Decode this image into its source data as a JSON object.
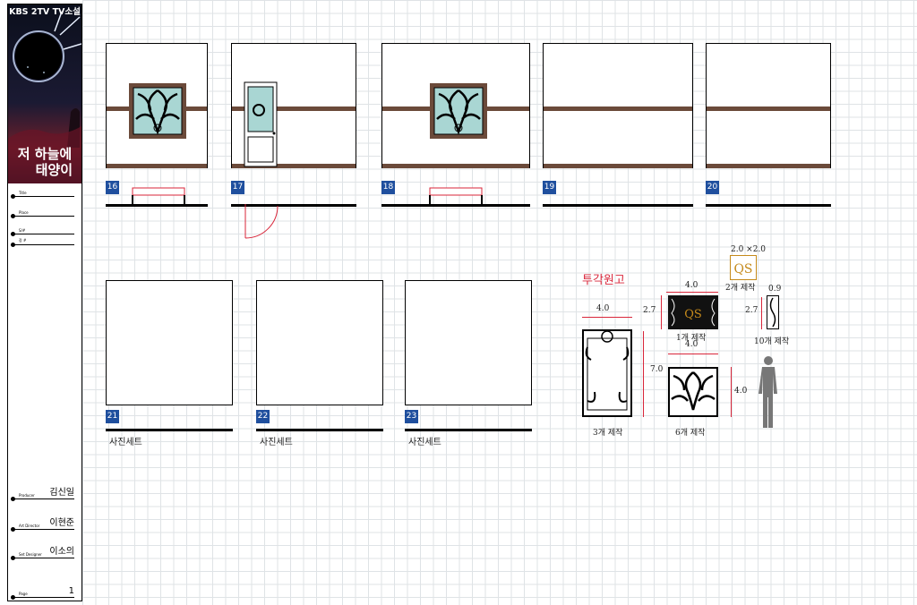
{
  "sidebar": {
    "poster_top": "KBS 2TV TV소설",
    "poster_title_line1": "저 하늘에",
    "poster_title_line2": "태양이",
    "fields_top": [
      {
        "label": "Title",
        "value": ""
      },
      {
        "label": "Place",
        "value": ""
      },
      {
        "label": "S/#",
        "value": ""
      },
      {
        "label": "장 #",
        "value": ""
      }
    ],
    "fields_bottom": [
      {
        "label": "Producer",
        "value": "김신일"
      },
      {
        "label": "Art Director",
        "value": "이현준"
      },
      {
        "label": "Set Designer",
        "value": "이소의"
      },
      {
        "label": "Page",
        "value": "1"
      }
    ]
  },
  "panels_row1": [
    {
      "num": "16",
      "feature": "window"
    },
    {
      "num": "17",
      "feature": "door"
    },
    {
      "num": "18",
      "feature": "window"
    },
    {
      "num": "19",
      "feature": "none"
    },
    {
      "num": "20",
      "feature": "none"
    }
  ],
  "panels_row2": [
    {
      "num": "21",
      "caption": "사진세트"
    },
    {
      "num": "22",
      "caption": "사진세트"
    },
    {
      "num": "23",
      "caption": "사진세트"
    }
  ],
  "drawing": {
    "title": "투각원고",
    "logo_size": "2.0 ×2.0",
    "logo_count": "2개 제작",
    "small_panel_w": "4.0",
    "small_panel_h": "2.7",
    "small_panel_count": "1개 제작",
    "narrow_w": "0.9",
    "narrow_h": "2.7",
    "narrow_count": "10개 제작",
    "tall_w": "4.0",
    "tall_h": "7.0",
    "tall_count": "3개 제작",
    "square_w": "4.0",
    "square_h": "4.0",
    "square_count": "6개 제작"
  },
  "colors": {
    "rail": "#6b4a3a",
    "tag": "#1f4f9e",
    "dim_red": "#d9263a",
    "glass": "#a9d6d3"
  }
}
